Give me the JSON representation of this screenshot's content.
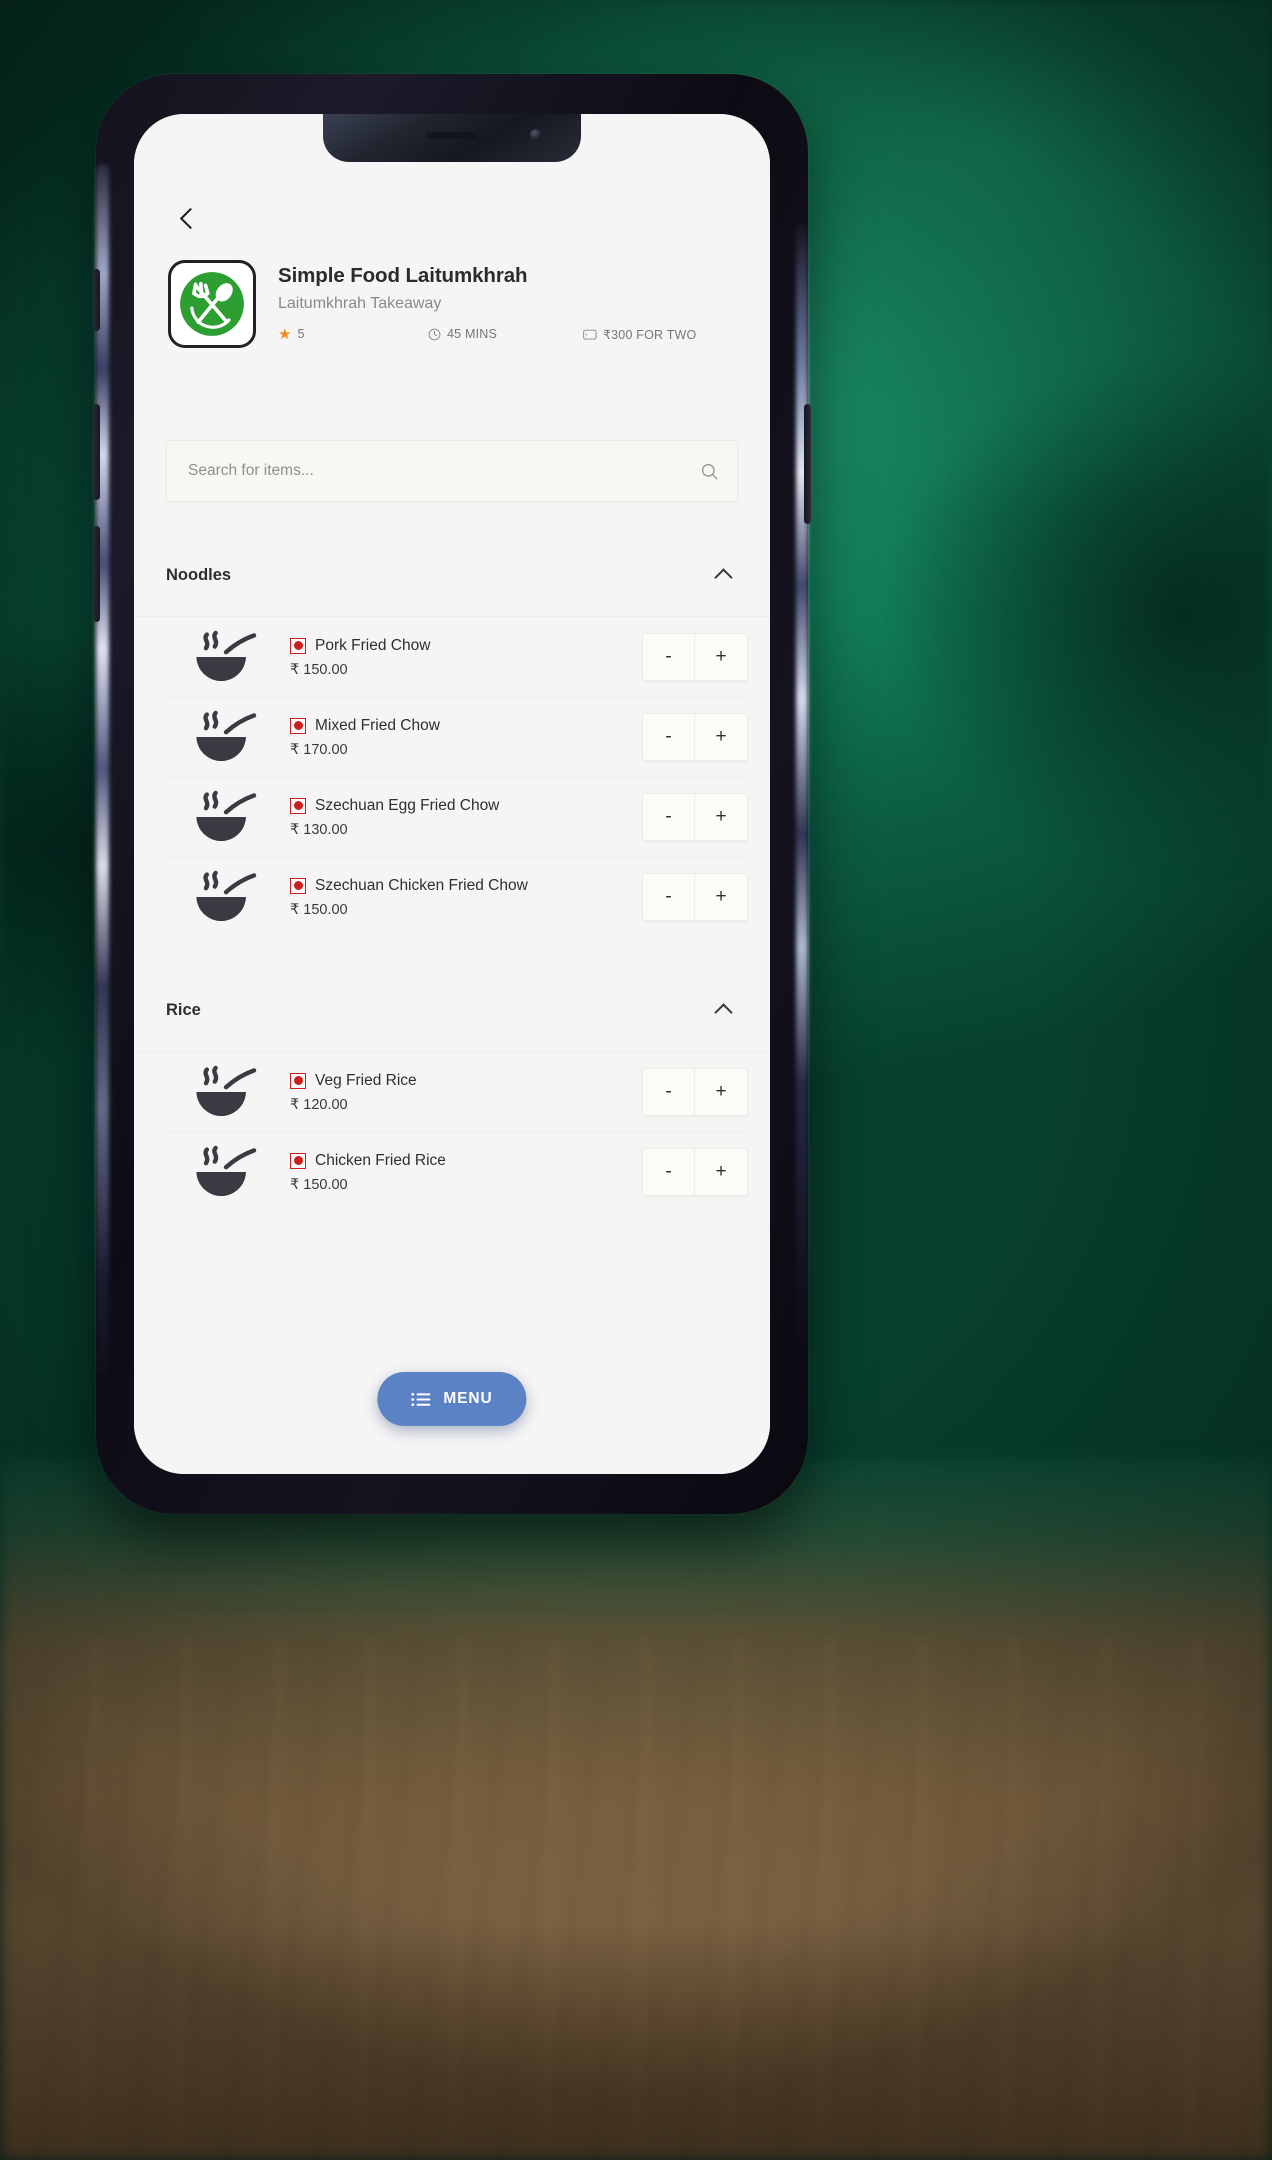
{
  "app": {
    "back_label": "Back",
    "restaurant": {
      "name": "Simple Food Laitumkhrah",
      "subtitle": "Laitumkhrah Takeaway",
      "rating": "5",
      "delivery_time": "45 MINS",
      "cost_for_two": "₹300 FOR TWO"
    },
    "search": {
      "placeholder": "Search for items...",
      "value": ""
    },
    "categories": [
      {
        "title": "Noodles",
        "expanded": true,
        "items": [
          {
            "name": "Pork Fried Chow",
            "price": "₹ 150.00",
            "type": "non-veg",
            "minus": "-",
            "plus": "+"
          },
          {
            "name": "Mixed Fried Chow",
            "price": "₹ 170.00",
            "type": "non-veg",
            "minus": "-",
            "plus": "+"
          },
          {
            "name": "Szechuan Egg Fried Chow",
            "price": "₹ 130.00",
            "type": "non-veg",
            "minus": "-",
            "plus": "+"
          },
          {
            "name": "Szechuan Chicken Fried Chow",
            "price": "₹ 150.00",
            "type": "non-veg",
            "minus": "-",
            "plus": "+"
          }
        ]
      },
      {
        "title": "Rice",
        "expanded": true,
        "items": [
          {
            "name": "Veg Fried Rice",
            "price": "₹ 120.00",
            "type": "non-veg",
            "minus": "-",
            "plus": "+"
          },
          {
            "name": "Chicken Fried Rice",
            "price": "₹ 150.00",
            "type": "non-veg",
            "minus": "-",
            "plus": "+"
          }
        ]
      }
    ],
    "fab": {
      "label": "MENU",
      "color": "#5b82c4"
    },
    "colors": {
      "accent": "#5b82c4",
      "star": "#f08c1a",
      "nonveg": "#cc1e1e",
      "logo_green": "#2d9e31",
      "screen_bg": "#f5f5f5"
    }
  }
}
